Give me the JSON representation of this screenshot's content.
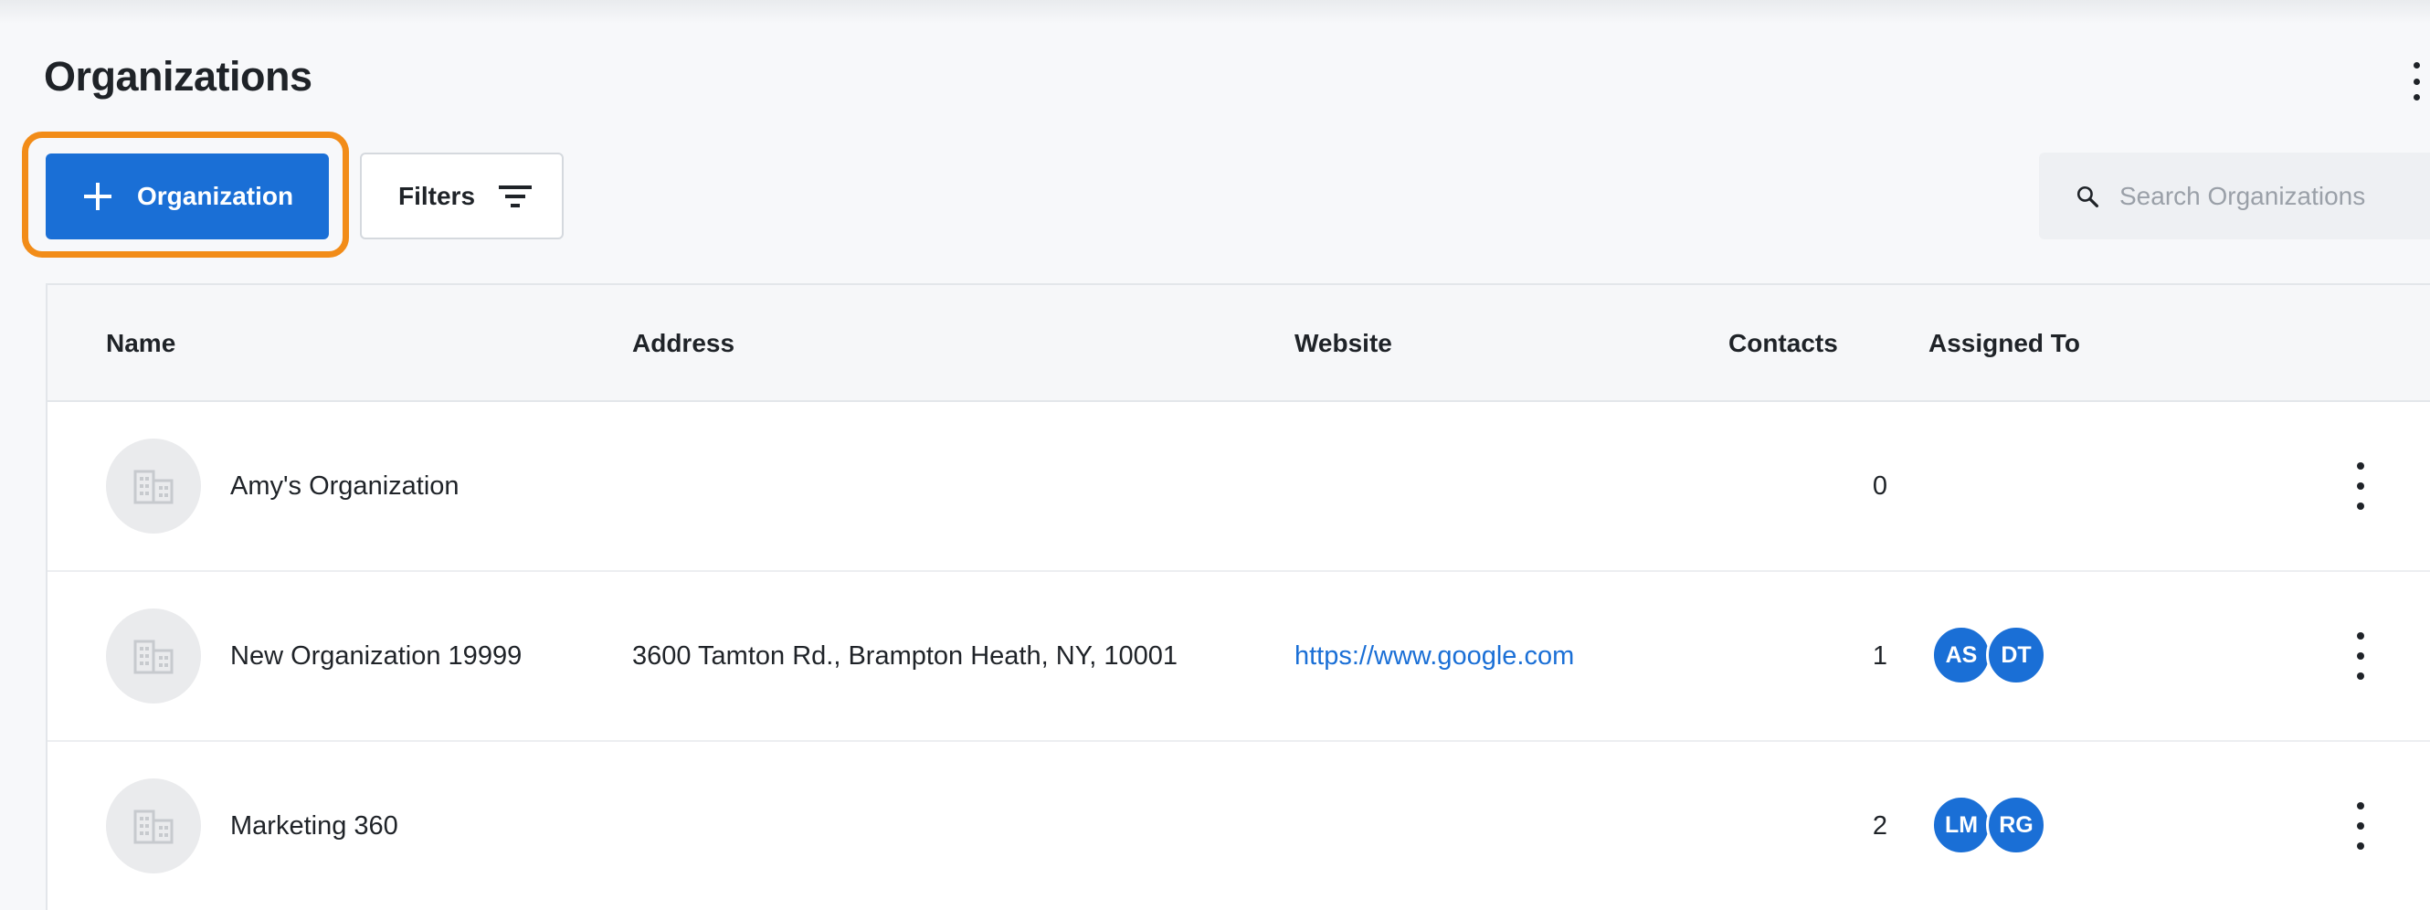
{
  "page": {
    "title": "Organizations"
  },
  "toolbar": {
    "add_label": "Organization",
    "filters_label": "Filters",
    "search_placeholder": "Search Organizations"
  },
  "table": {
    "columns": [
      "Name",
      "Address",
      "Website",
      "Contacts",
      "Assigned To"
    ],
    "rows": [
      {
        "name": "Amy's Organization",
        "address": "",
        "website": "",
        "contacts": "0",
        "assigned": []
      },
      {
        "name": "New Organization 19999",
        "address": "3600 Tamton Rd., Brampton Heath, NY, 10001",
        "website": "https://www.google.com",
        "contacts": "1",
        "assigned": [
          "AS",
          "DT"
        ]
      },
      {
        "name": "Marketing 360",
        "address": "",
        "website": "",
        "contacts": "2",
        "assigned": [
          "LM",
          "RG"
        ]
      }
    ]
  },
  "colors": {
    "primary": "#1a6fd6",
    "highlight": "#f28c18",
    "background": "#f7f8fa",
    "avatar_placeholder": "#eaebed"
  },
  "icons": {
    "add": "plus-icon",
    "filters": "filter-icon",
    "search": "search-icon",
    "organization": "building-icon",
    "menu": "more-vertical-icon"
  }
}
